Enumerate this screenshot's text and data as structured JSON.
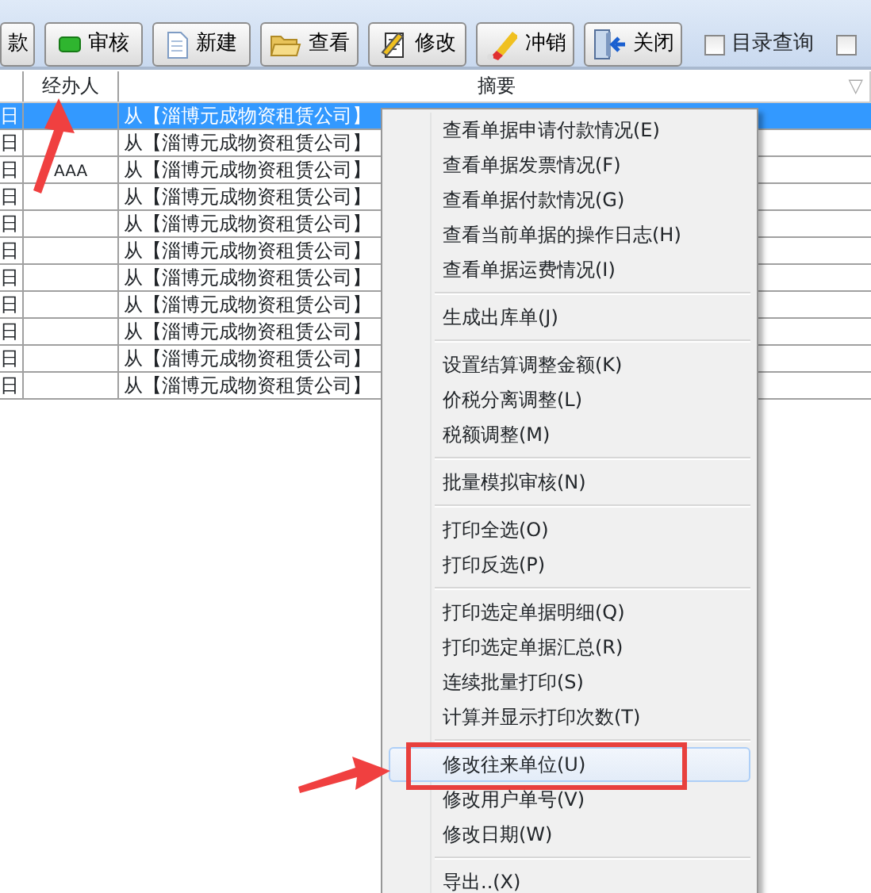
{
  "toolbar": {
    "buttons": [
      {
        "label": "款"
      },
      {
        "label": "审核"
      },
      {
        "label": "新建"
      },
      {
        "label": "查看"
      },
      {
        "label": "修改"
      },
      {
        "label": "冲销"
      },
      {
        "label": "关闭"
      }
    ],
    "checkboxes": [
      {
        "label": "目录查询",
        "checked": false
      },
      {
        "checked": false
      }
    ]
  },
  "table": {
    "columns": [
      {
        "label": "经办人"
      },
      {
        "label": "摘要",
        "sort_mark": "▽"
      }
    ],
    "rows": [
      {
        "date": "日",
        "summary": "从【淄博元成物资租赁公司】",
        "selected": true
      },
      {
        "date": "日",
        "summary": "从【淄博元成物资租赁公司】",
        "selected": false
      },
      {
        "date": "日",
        "handler": "AAA",
        "summary": "从【淄博元成物资租赁公司】",
        "selected": false
      },
      {
        "date": "日",
        "summary": "从【淄博元成物资租赁公司】",
        "selected": false
      },
      {
        "date": "日",
        "summary": "从【淄博元成物资租赁公司】",
        "selected": false
      },
      {
        "date": "日",
        "summary": "从【淄博元成物资租赁公司】",
        "selected": false
      },
      {
        "date": "日",
        "summary": "从【淄博元成物资租赁公司】",
        "selected": false
      },
      {
        "date": "日",
        "summary": "从【淄博元成物资租赁公司】",
        "selected": false
      },
      {
        "date": "日",
        "summary": "从【淄博元成物资租赁公司】",
        "selected": false
      },
      {
        "date": "日",
        "summary": "从【淄博元成物资租赁公司】",
        "selected": false
      },
      {
        "date": "日",
        "summary": "从【淄博元成物资租赁公司】",
        "selected": false
      }
    ]
  },
  "context_menu": {
    "groups": [
      [
        {
          "label": "查看单据申请付款情况(E)",
          "selected": false
        },
        {
          "label": "查看单据发票情况(F)",
          "selected": false
        },
        {
          "label": "查看单据付款情况(G)",
          "selected": false
        },
        {
          "label": "查看当前单据的操作日志(H)",
          "selected": false
        },
        {
          "label": "查看单据运费情况(I)",
          "selected": false
        }
      ],
      [
        {
          "label": "生成出库单(J)",
          "selected": false
        }
      ],
      [
        {
          "label": "设置结算调整金额(K)",
          "selected": false
        },
        {
          "label": "价税分离调整(L)",
          "selected": false
        },
        {
          "label": "税额调整(M)",
          "selected": false
        }
      ],
      [
        {
          "label": "批量模拟审核(N)",
          "selected": false
        }
      ],
      [
        {
          "label": "打印全选(O)",
          "selected": false
        },
        {
          "label": "打印反选(P)",
          "selected": false
        }
      ],
      [
        {
          "label": "打印选定单据明细(Q)",
          "selected": false
        },
        {
          "label": "打印选定单据汇总(R)",
          "selected": false
        },
        {
          "label": "连续批量打印(S)",
          "selected": false
        },
        {
          "label": "计算并显示打印次数(T)",
          "selected": false
        }
      ],
      [
        {
          "label": "修改往来单位(U)",
          "selected": true
        },
        {
          "label": "修改用户单号(V)",
          "selected": false
        },
        {
          "label": "修改日期(W)",
          "selected": false
        }
      ],
      [
        {
          "label": "导出..(X)",
          "selected": false
        }
      ]
    ]
  }
}
